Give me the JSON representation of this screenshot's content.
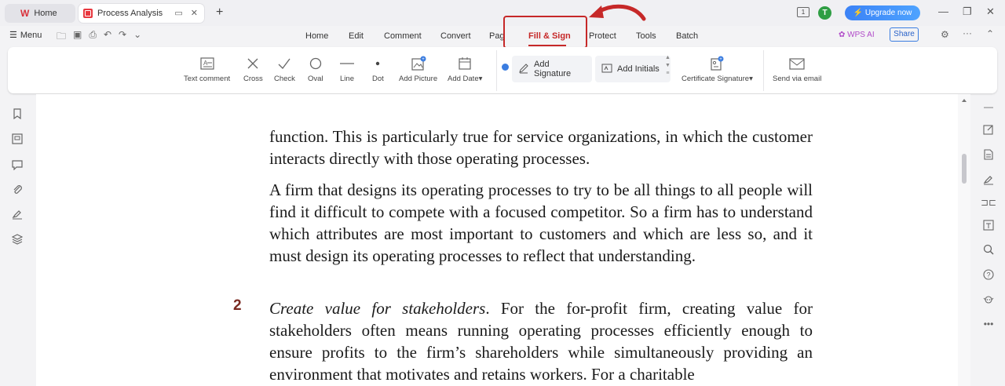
{
  "tabs": {
    "home_label": "Home",
    "doc_label": "Process Analysis"
  },
  "titlebar": {
    "upgrade_label": "Upgrade now",
    "avatar_initial": "T",
    "page_badge": "1"
  },
  "menubar": {
    "menu_label": "Menu",
    "nav": [
      "Home",
      "Edit",
      "Comment",
      "Convert",
      "Page",
      "Fill & Sign",
      "Protect",
      "Tools",
      "Batch"
    ],
    "active": "Fill & Sign",
    "wps_ai": "WPS AI",
    "share": "Share"
  },
  "ribbon": {
    "text_comment": "Text comment",
    "cross": "Cross",
    "check": "Check",
    "oval": "Oval",
    "line": "Line",
    "dot": "Dot",
    "add_picture": "Add Picture",
    "add_date": "Add Date",
    "add_signature": "Add Signature",
    "add_initials": "Add Initials",
    "certificate_signature": "Certificate Signature",
    "send_via_email": "Send via email"
  },
  "document": {
    "p1": "function. This is particularly true for service organizations, in which the customer interacts directly with those operating processes.",
    "p2": "A firm that designs its operating processes to try to be all things to all people will find it difficult to compete with a focused competitor. So a firm has to understand which attributes are most important to customers and which are less so, and it must design its operating processes to reflect that understanding.",
    "item_number": "2",
    "p3_italic": "Create value for stakeholders",
    "p3_rest": ". For the for-profit firm, creating value for stakeholders often means running operating processes efficiently enough to ensure profits to the firm’s shareholders while simultaneously providing an environment that motivates and retains workers. For a charitable"
  },
  "colors": {
    "accent": "#c62828",
    "upgrade": "#3b82f6",
    "number": "#7a2a22"
  }
}
